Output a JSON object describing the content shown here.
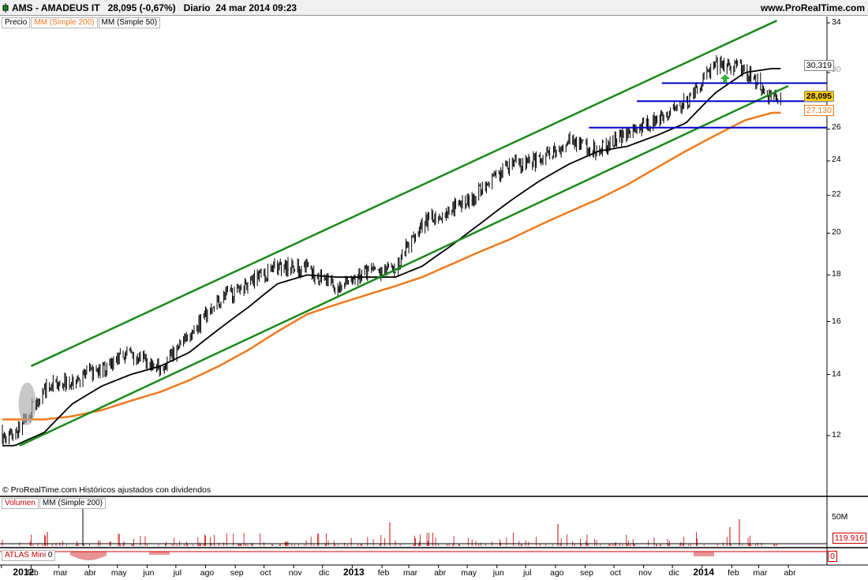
{
  "header": {
    "ticker": "AMS - AMADEUS IT",
    "price": "28,095 (-0,67%)",
    "period": "Diario",
    "datetime": "24 mar 2014 09:23",
    "site": "www.ProRealTime.com"
  },
  "price_panel": {
    "tags": [
      "Precio",
      "MM (Simple 200)",
      "MM (Simple 50)"
    ],
    "source_note": "© ProRealTime.com  Históricos ajustados con dividendos",
    "y_ticks": [
      "34",
      "26",
      "24",
      "22",
      "20",
      "18",
      "16",
      "14",
      "12"
    ],
    "y_hidden_tick": "30",
    "labels": {
      "ma50": "30,319",
      "last": "28,095",
      "ma200": "27,130"
    },
    "colors": {
      "channel": "#1a8a1a",
      "ma200": "#f07a1e",
      "ma50": "#000000",
      "support": "#0000cc",
      "last_label_bg": "#ffcc00"
    }
  },
  "volume_panel": {
    "tags": [
      "Volumen",
      "MM (Simple 200)"
    ],
    "y_tick": "50M",
    "ma_label": "119.916"
  },
  "atlas_panel": {
    "tag_name": "ATLAS Mini",
    "tag_value": "0",
    "y_tick": "0"
  },
  "x_axis": {
    "labels": [
      {
        "text": "2012",
        "year": true
      },
      {
        "text": "feb"
      },
      {
        "text": "mar"
      },
      {
        "text": "abr"
      },
      {
        "text": "may"
      },
      {
        "text": "jun"
      },
      {
        "text": "jul"
      },
      {
        "text": "ago"
      },
      {
        "text": "sep"
      },
      {
        "text": "oct"
      },
      {
        "text": "nov"
      },
      {
        "text": "dic"
      },
      {
        "text": "2013",
        "year": true
      },
      {
        "text": "feb"
      },
      {
        "text": "mar"
      },
      {
        "text": "abr"
      },
      {
        "text": "may"
      },
      {
        "text": "jun"
      },
      {
        "text": "jul"
      },
      {
        "text": "ago"
      },
      {
        "text": "sep"
      },
      {
        "text": "oct"
      },
      {
        "text": "nov"
      },
      {
        "text": "dic"
      },
      {
        "text": "2014",
        "year": true
      },
      {
        "text": "feb"
      },
      {
        "text": "mar"
      },
      {
        "text": "abr"
      }
    ]
  },
  "chart_data": {
    "type": "candlestick",
    "title": "AMS - AMADEUS IT",
    "scale": "log",
    "ylim": [
      10.5,
      34.5
    ],
    "date_range": [
      "2012-01-02",
      "2014-03-24"
    ],
    "close_monthly": [
      {
        "date": "2012-01",
        "close": 12.0
      },
      {
        "date": "2012-02",
        "close": 13.5
      },
      {
        "date": "2012-03",
        "close": 13.8
      },
      {
        "date": "2012-04",
        "close": 14.2
      },
      {
        "date": "2012-05",
        "close": 14.8
      },
      {
        "date": "2012-06",
        "close": 14.2
      },
      {
        "date": "2012-07",
        "close": 15.4
      },
      {
        "date": "2012-08",
        "close": 16.9
      },
      {
        "date": "2012-09",
        "close": 17.6
      },
      {
        "date": "2012-10",
        "close": 18.4
      },
      {
        "date": "2012-11",
        "close": 18.3
      },
      {
        "date": "2012-12",
        "close": 17.4
      },
      {
        "date": "2013-01",
        "close": 18.1
      },
      {
        "date": "2013-02",
        "close": 18.3
      },
      {
        "date": "2013-03",
        "close": 20.5
      },
      {
        "date": "2013-04",
        "close": 21.2
      },
      {
        "date": "2013-05",
        "close": 22.2
      },
      {
        "date": "2013-06",
        "close": 23.8
      },
      {
        "date": "2013-07",
        "close": 24.0
      },
      {
        "date": "2013-08",
        "close": 25.2
      },
      {
        "date": "2013-09",
        "close": 24.6
      },
      {
        "date": "2013-10",
        "close": 25.8
      },
      {
        "date": "2013-11",
        "close": 26.5
      },
      {
        "date": "2013-12",
        "close": 27.8
      },
      {
        "date": "2014-01",
        "close": 30.6
      },
      {
        "date": "2014-02",
        "close": 30.2
      },
      {
        "date": "2014-03",
        "close": 28.1
      }
    ],
    "ma200_monthly": [
      12.5,
      12.5,
      12.6,
      12.8,
      13.1,
      13.4,
      13.8,
      14.3,
      14.9,
      15.6,
      16.3,
      16.7,
      17.1,
      17.5,
      17.9,
      18.5,
      19.1,
      19.7,
      20.4,
      21.1,
      21.8,
      22.6,
      23.6,
      24.6,
      25.6,
      26.6,
      27.1
    ],
    "ma50_monthly": [
      11.7,
      12.1,
      13.0,
      13.6,
      14.0,
      14.3,
      14.8,
      15.7,
      16.6,
      17.6,
      18.0,
      17.9,
      17.9,
      17.9,
      18.4,
      19.4,
      20.5,
      21.7,
      22.8,
      23.8,
      24.6,
      24.9,
      25.6,
      26.4,
      28.5,
      30.0,
      30.3
    ],
    "channel_upper": [
      {
        "date": "2012-02-01",
        "value": 14.3
      },
      {
        "date": "2014-03-20",
        "value": 34.2
      }
    ],
    "channel_lower": [
      {
        "date": "2012-01-20",
        "value": 11.7
      },
      {
        "date": "2014-04-01",
        "value": 29.0
      }
    ],
    "support_lines": [
      26.1,
      27.9,
      29.2
    ],
    "last_price": 28.095,
    "ma50_last": 30.319,
    "ma200_last": 27.13
  }
}
